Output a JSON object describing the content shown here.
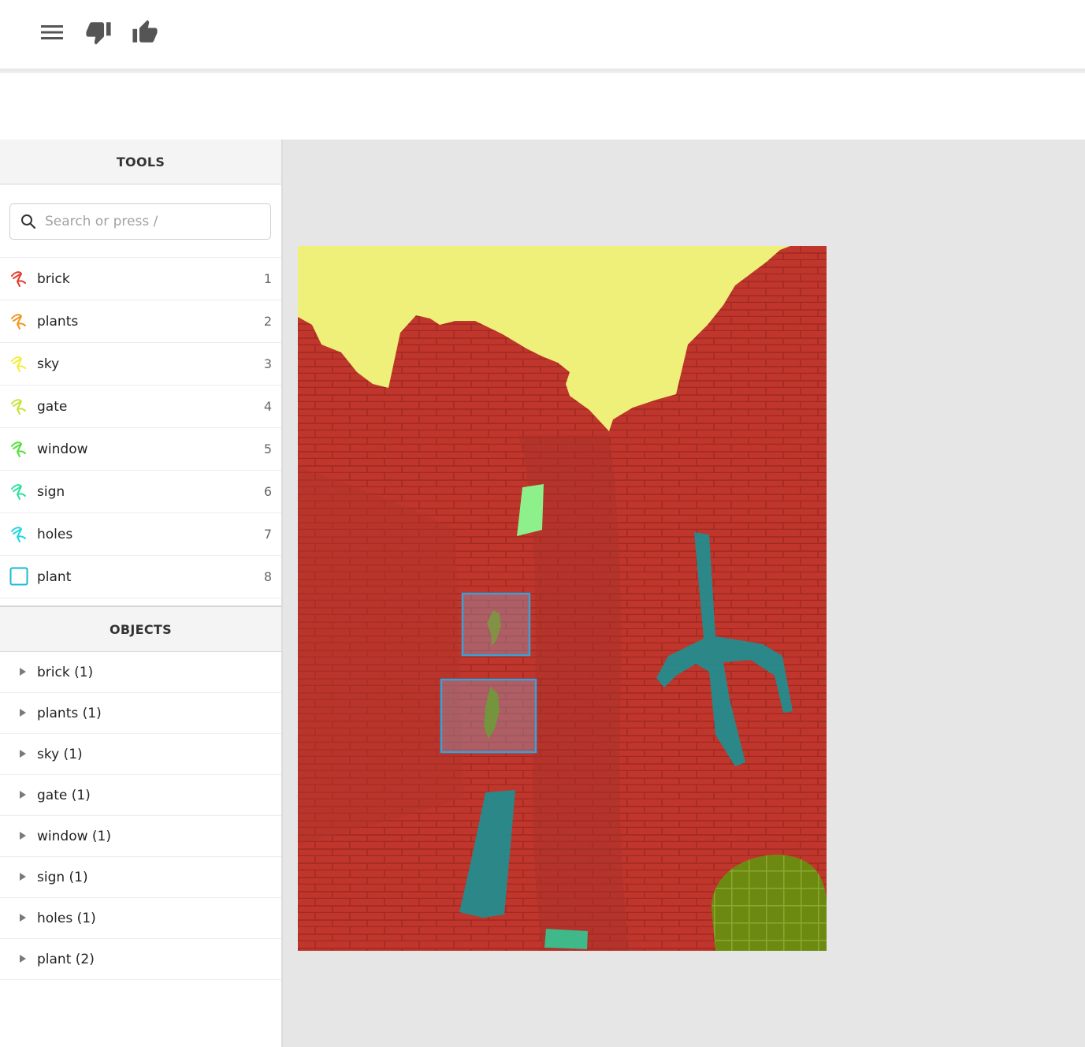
{
  "toolbar": {
    "icons": [
      "menu-icon",
      "thumbs-down-icon",
      "thumbs-up-icon"
    ]
  },
  "tools_panel": {
    "title": "TOOLS",
    "search_placeholder": "Search or press /",
    "tools": [
      {
        "label": "brick",
        "key": "1",
        "color": "#e53b2c",
        "icon": "polygon-tool-icon"
      },
      {
        "label": "plants",
        "key": "2",
        "color": "#f2961f",
        "icon": "polygon-tool-icon"
      },
      {
        "label": "sky",
        "key": "3",
        "color": "#f2ee3a",
        "icon": "polygon-tool-icon"
      },
      {
        "label": "gate",
        "key": "4",
        "color": "#c8e33a",
        "icon": "polygon-tool-icon"
      },
      {
        "label": "window",
        "key": "5",
        "color": "#53e03a",
        "icon": "polygon-tool-icon"
      },
      {
        "label": "sign",
        "key": "6",
        "color": "#2fe0a0",
        "icon": "polygon-tool-icon"
      },
      {
        "label": "holes",
        "key": "7",
        "color": "#22d6e0",
        "icon": "polygon-tool-icon"
      },
      {
        "label": "plant",
        "key": "8",
        "color": "#1ab9d6",
        "icon": "bounding-box-icon"
      }
    ]
  },
  "objects_panel": {
    "title": "OBJECTS",
    "groups": [
      {
        "label": "brick (1)"
      },
      {
        "label": "plants (1)"
      },
      {
        "label": "sky (1)"
      },
      {
        "label": "gate (1)"
      },
      {
        "label": "window (1)"
      },
      {
        "label": "sign (1)"
      },
      {
        "label": "holes (1)"
      },
      {
        "label": "plant (2)"
      }
    ]
  },
  "annotation": {
    "colors": {
      "canvas_bg": "#e6e6e6",
      "brick": "#c0362c",
      "sky": "#eef07a",
      "window": "#8ef08a",
      "holes": "#1f8f90",
      "gate": "#6d8a10",
      "sign": "#3fb88a",
      "plant_box": "#3aa0d6"
    }
  }
}
